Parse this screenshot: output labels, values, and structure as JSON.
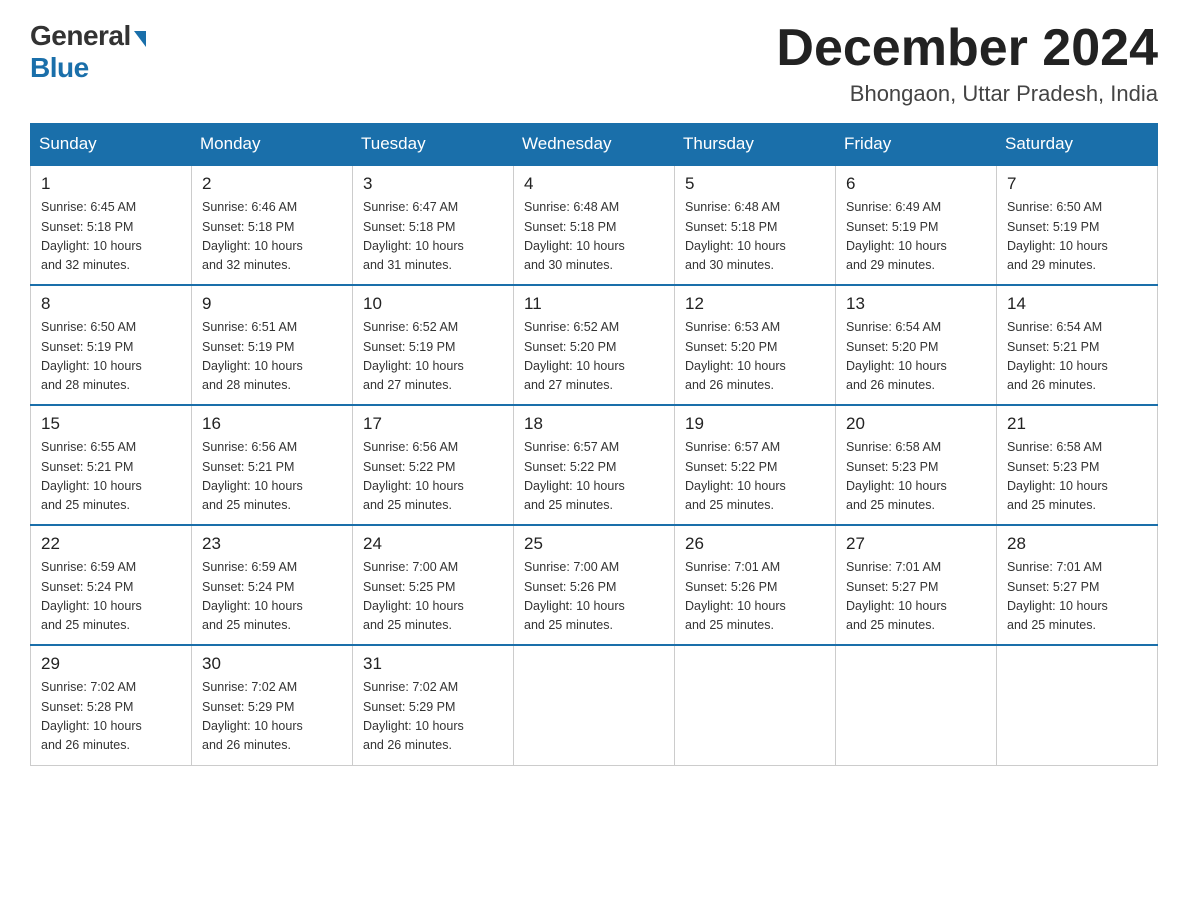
{
  "logo": {
    "general": "General",
    "blue": "Blue",
    "triangle": "▶"
  },
  "title": "December 2024",
  "location": "Bhongaon, Uttar Pradesh, India",
  "headers": [
    "Sunday",
    "Monday",
    "Tuesday",
    "Wednesday",
    "Thursday",
    "Friday",
    "Saturday"
  ],
  "weeks": [
    [
      {
        "day": "1",
        "sunrise": "6:45 AM",
        "sunset": "5:18 PM",
        "daylight": "10 hours and 32 minutes."
      },
      {
        "day": "2",
        "sunrise": "6:46 AM",
        "sunset": "5:18 PM",
        "daylight": "10 hours and 32 minutes."
      },
      {
        "day": "3",
        "sunrise": "6:47 AM",
        "sunset": "5:18 PM",
        "daylight": "10 hours and 31 minutes."
      },
      {
        "day": "4",
        "sunrise": "6:48 AM",
        "sunset": "5:18 PM",
        "daylight": "10 hours and 30 minutes."
      },
      {
        "day": "5",
        "sunrise": "6:48 AM",
        "sunset": "5:18 PM",
        "daylight": "10 hours and 30 minutes."
      },
      {
        "day": "6",
        "sunrise": "6:49 AM",
        "sunset": "5:19 PM",
        "daylight": "10 hours and 29 minutes."
      },
      {
        "day": "7",
        "sunrise": "6:50 AM",
        "sunset": "5:19 PM",
        "daylight": "10 hours and 29 minutes."
      }
    ],
    [
      {
        "day": "8",
        "sunrise": "6:50 AM",
        "sunset": "5:19 PM",
        "daylight": "10 hours and 28 minutes."
      },
      {
        "day": "9",
        "sunrise": "6:51 AM",
        "sunset": "5:19 PM",
        "daylight": "10 hours and 28 minutes."
      },
      {
        "day": "10",
        "sunrise": "6:52 AM",
        "sunset": "5:19 PM",
        "daylight": "10 hours and 27 minutes."
      },
      {
        "day": "11",
        "sunrise": "6:52 AM",
        "sunset": "5:20 PM",
        "daylight": "10 hours and 27 minutes."
      },
      {
        "day": "12",
        "sunrise": "6:53 AM",
        "sunset": "5:20 PM",
        "daylight": "10 hours and 26 minutes."
      },
      {
        "day": "13",
        "sunrise": "6:54 AM",
        "sunset": "5:20 PM",
        "daylight": "10 hours and 26 minutes."
      },
      {
        "day": "14",
        "sunrise": "6:54 AM",
        "sunset": "5:21 PM",
        "daylight": "10 hours and 26 minutes."
      }
    ],
    [
      {
        "day": "15",
        "sunrise": "6:55 AM",
        "sunset": "5:21 PM",
        "daylight": "10 hours and 25 minutes."
      },
      {
        "day": "16",
        "sunrise": "6:56 AM",
        "sunset": "5:21 PM",
        "daylight": "10 hours and 25 minutes."
      },
      {
        "day": "17",
        "sunrise": "6:56 AM",
        "sunset": "5:22 PM",
        "daylight": "10 hours and 25 minutes."
      },
      {
        "day": "18",
        "sunrise": "6:57 AM",
        "sunset": "5:22 PM",
        "daylight": "10 hours and 25 minutes."
      },
      {
        "day": "19",
        "sunrise": "6:57 AM",
        "sunset": "5:22 PM",
        "daylight": "10 hours and 25 minutes."
      },
      {
        "day": "20",
        "sunrise": "6:58 AM",
        "sunset": "5:23 PM",
        "daylight": "10 hours and 25 minutes."
      },
      {
        "day": "21",
        "sunrise": "6:58 AM",
        "sunset": "5:23 PM",
        "daylight": "10 hours and 25 minutes."
      }
    ],
    [
      {
        "day": "22",
        "sunrise": "6:59 AM",
        "sunset": "5:24 PM",
        "daylight": "10 hours and 25 minutes."
      },
      {
        "day": "23",
        "sunrise": "6:59 AM",
        "sunset": "5:24 PM",
        "daylight": "10 hours and 25 minutes."
      },
      {
        "day": "24",
        "sunrise": "7:00 AM",
        "sunset": "5:25 PM",
        "daylight": "10 hours and 25 minutes."
      },
      {
        "day": "25",
        "sunrise": "7:00 AM",
        "sunset": "5:26 PM",
        "daylight": "10 hours and 25 minutes."
      },
      {
        "day": "26",
        "sunrise": "7:01 AM",
        "sunset": "5:26 PM",
        "daylight": "10 hours and 25 minutes."
      },
      {
        "day": "27",
        "sunrise": "7:01 AM",
        "sunset": "5:27 PM",
        "daylight": "10 hours and 25 minutes."
      },
      {
        "day": "28",
        "sunrise": "7:01 AM",
        "sunset": "5:27 PM",
        "daylight": "10 hours and 25 minutes."
      }
    ],
    [
      {
        "day": "29",
        "sunrise": "7:02 AM",
        "sunset": "5:28 PM",
        "daylight": "10 hours and 26 minutes."
      },
      {
        "day": "30",
        "sunrise": "7:02 AM",
        "sunset": "5:29 PM",
        "daylight": "10 hours and 26 minutes."
      },
      {
        "day": "31",
        "sunrise": "7:02 AM",
        "sunset": "5:29 PM",
        "daylight": "10 hours and 26 minutes."
      },
      null,
      null,
      null,
      null
    ]
  ],
  "labels": {
    "sunrise": "Sunrise:",
    "sunset": "Sunset:",
    "daylight": "Daylight:"
  }
}
